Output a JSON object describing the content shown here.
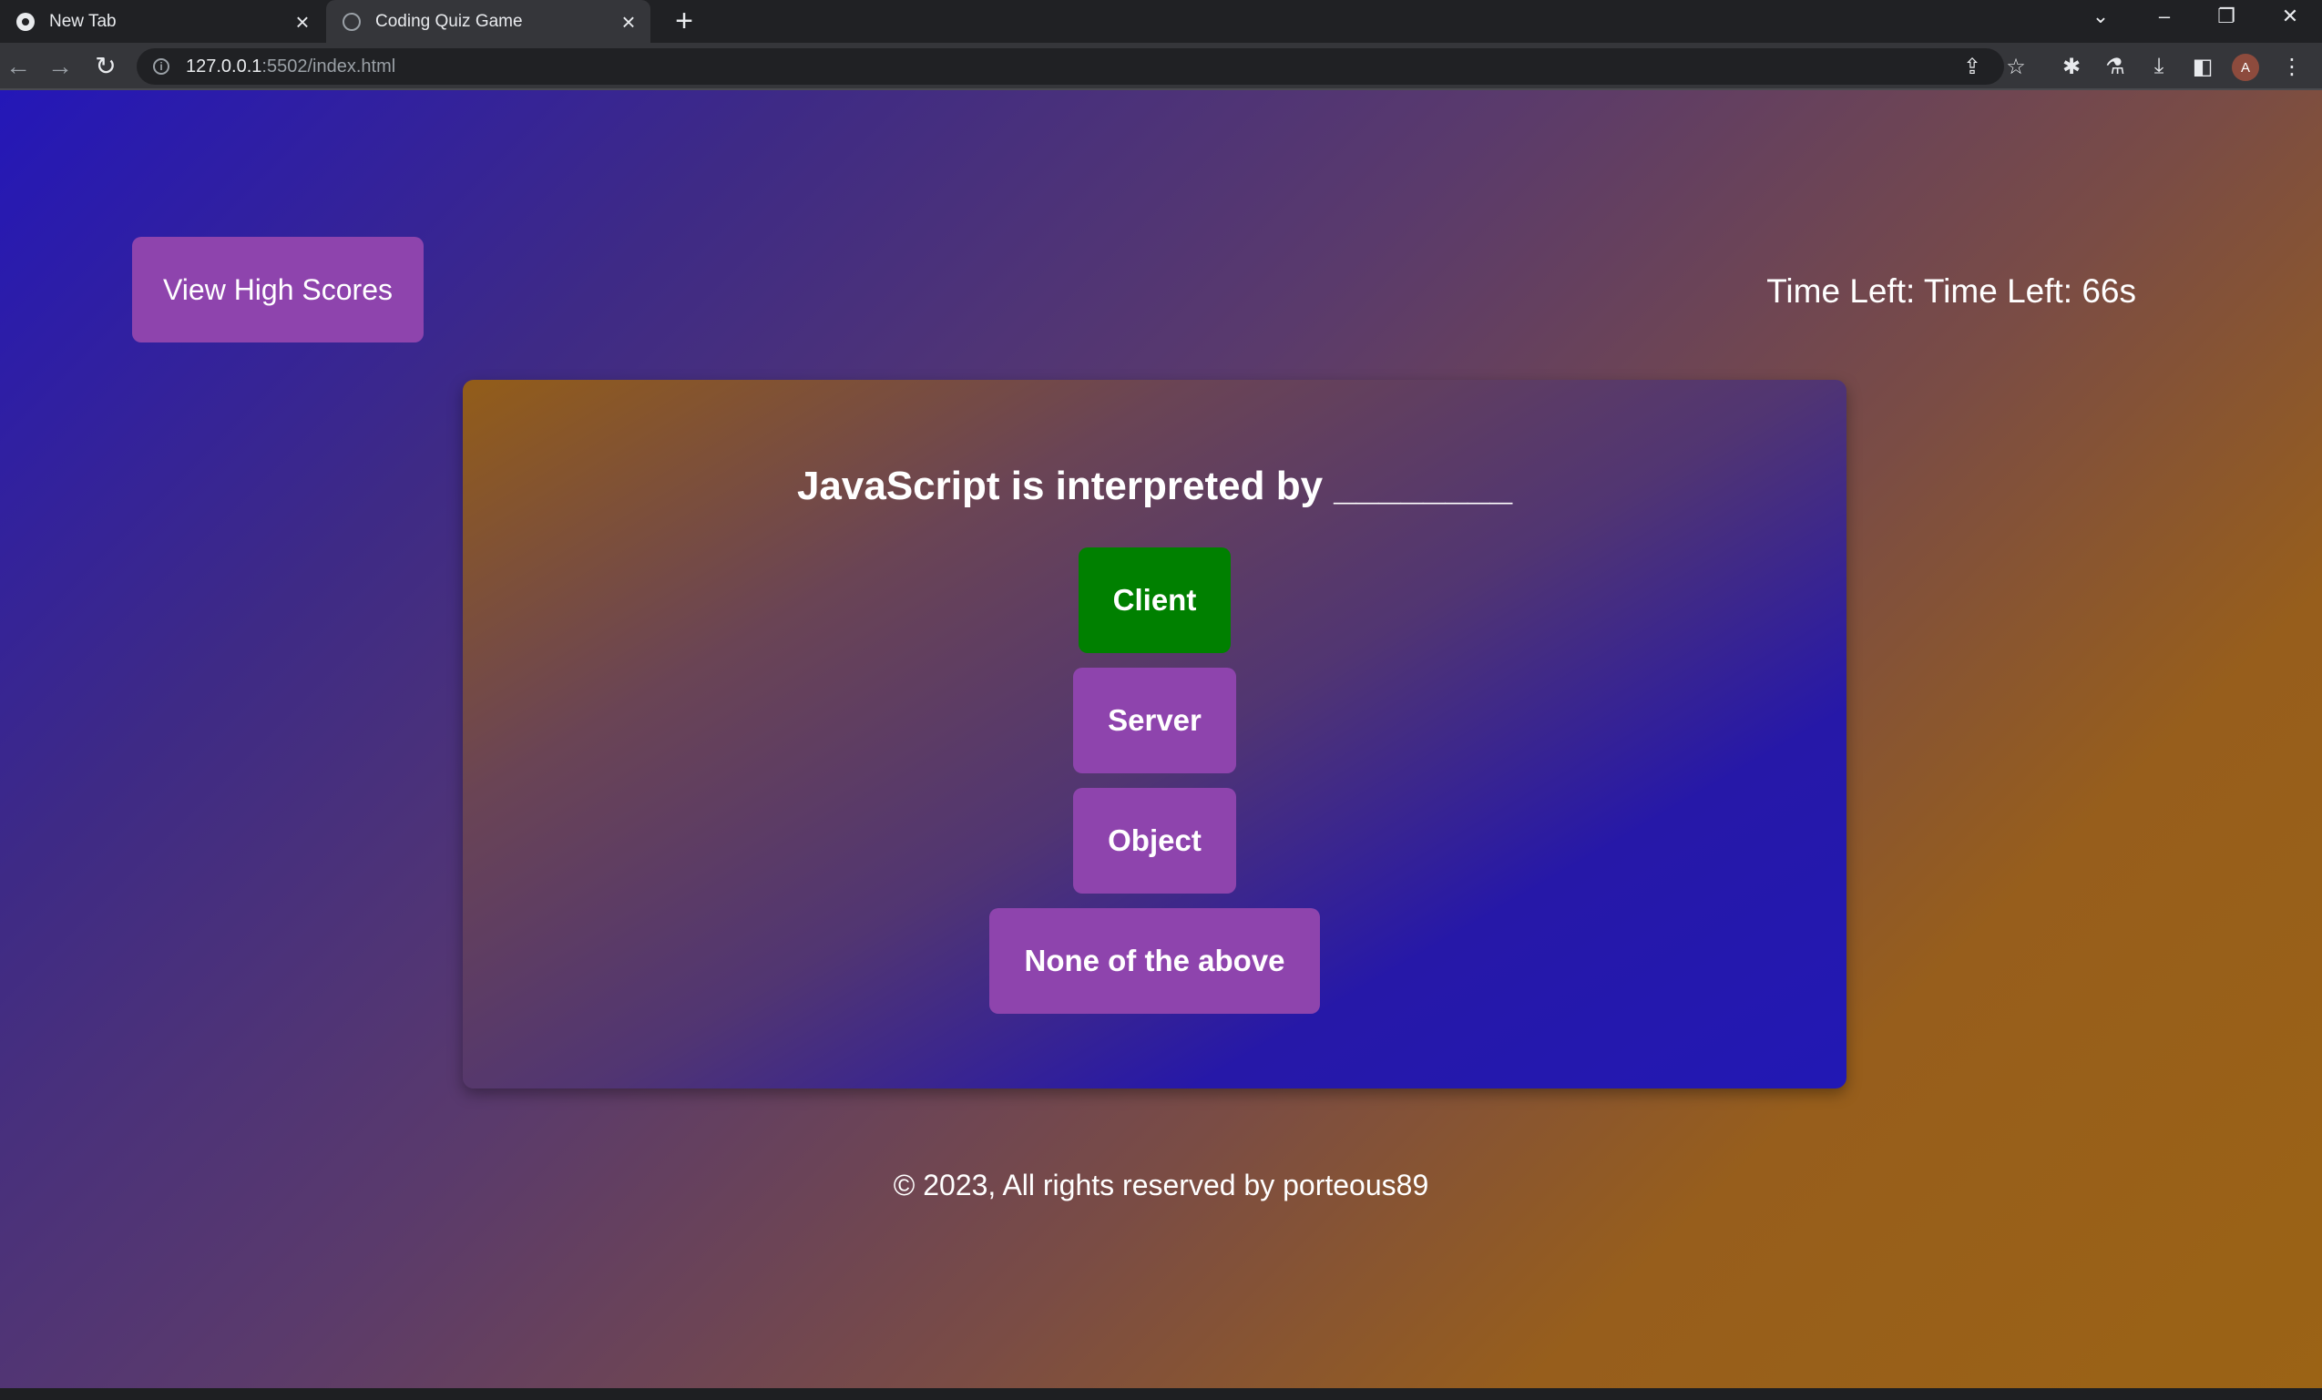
{
  "browser": {
    "tabs": [
      {
        "title": "New Tab",
        "active": false
      },
      {
        "title": "Coding Quiz Game",
        "active": true
      }
    ],
    "address_bar": {
      "host": "127.0.0.1",
      "path": ":5502/index.html"
    },
    "profile_initial": "A"
  },
  "header": {
    "high_scores_label": "View High Scores",
    "timer_text": "Time Left: Time Left: 66s"
  },
  "quiz": {
    "question": "JavaScript is interpreted by ________",
    "answers": [
      {
        "label": "Client",
        "state": "correct"
      },
      {
        "label": "Server",
        "state": "default"
      },
      {
        "label": "Object",
        "state": "default"
      },
      {
        "label": "None of the above",
        "state": "default"
      }
    ]
  },
  "footer": {
    "text": "© 2023, All rights reserved by porteous89"
  },
  "colors": {
    "button_purple": "#8e44ad",
    "correct_green": "#008000",
    "text_white": "#ffffff"
  }
}
